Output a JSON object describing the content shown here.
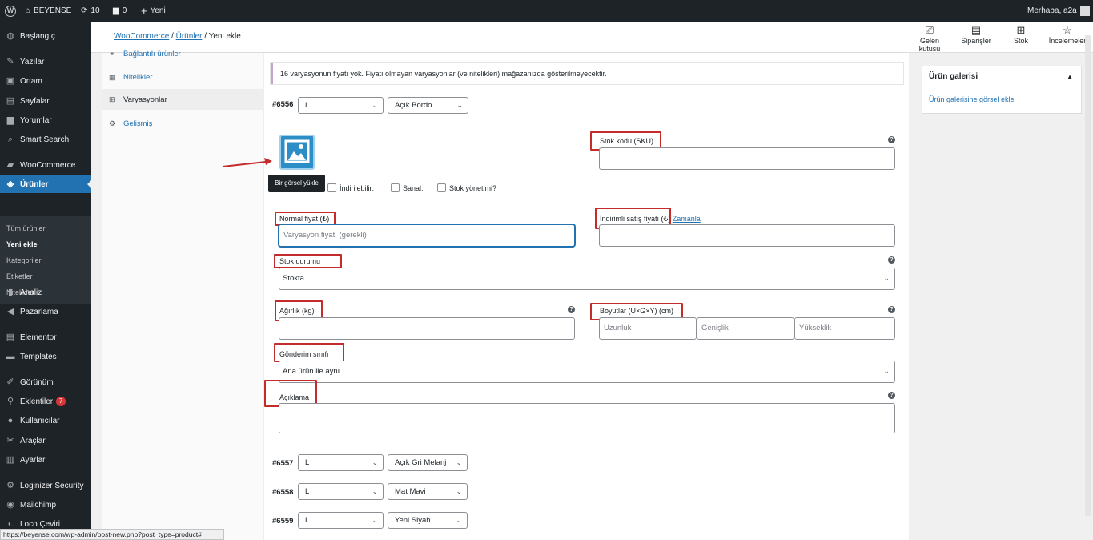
{
  "adminbar": {
    "site_name": "BEYENSE",
    "updates_count": "10",
    "comments_count": "0",
    "new_label": "Yeni",
    "greeting": "Merhaba, a2a"
  },
  "sidebar": {
    "items": [
      {
        "label": "Başlangıç",
        "icon": "dashboard-icon"
      },
      {
        "label": "Yazılar",
        "icon": "pin-icon"
      },
      {
        "label": "Ortam",
        "icon": "media-icon"
      },
      {
        "label": "Sayfalar",
        "icon": "page-icon"
      },
      {
        "label": "Yorumlar",
        "icon": "comment-icon"
      },
      {
        "label": "Smart Search",
        "icon": "search-icon"
      },
      {
        "label": "WooCommerce",
        "icon": "woo-icon"
      },
      {
        "label": "Ürünler",
        "icon": "box-icon"
      },
      {
        "label": "Analiz",
        "icon": "chart-icon"
      },
      {
        "label": "Pazarlama",
        "icon": "megaphone-icon"
      },
      {
        "label": "Elementor",
        "icon": "elementor-icon"
      },
      {
        "label": "Templates",
        "icon": "folder-icon"
      },
      {
        "label": "Görünüm",
        "icon": "brush-icon"
      },
      {
        "label": "Eklentiler",
        "icon": "plugin-icon",
        "badge": "7"
      },
      {
        "label": "Kullanıcılar",
        "icon": "user-icon"
      },
      {
        "label": "Araçlar",
        "icon": "wrench-icon"
      },
      {
        "label": "Ayarlar",
        "icon": "settings-icon"
      },
      {
        "label": "Loginizer Security",
        "icon": "gear-icon"
      },
      {
        "label": "Mailchimp",
        "icon": "mailchimp-icon"
      },
      {
        "label": "Loco Çeviri",
        "icon": "translate-icon"
      }
    ],
    "submenu": [
      "Tüm ürünler",
      "Yeni ekle",
      "Kategoriler",
      "Etiketler",
      "Nitelikler"
    ]
  },
  "header": {
    "breadcrumb": {
      "woocommerce": "WooCommerce",
      "urunler": "Ürünler",
      "current": "Yeni ekle"
    },
    "actions": [
      {
        "label": "Gelen kutusu",
        "icon": "inbox-icon"
      },
      {
        "label": "Siparişler",
        "icon": "orders-icon"
      },
      {
        "label": "Stok",
        "icon": "stock-icon"
      },
      {
        "label": "İncelemeler",
        "icon": "star-icon"
      }
    ]
  },
  "tabs": [
    {
      "label": "Bağlantılı ürünler",
      "icon": "link-icon"
    },
    {
      "label": "Nitelikler",
      "icon": "attributes-icon"
    },
    {
      "label": "Varyasyonlar",
      "icon": "grid-icon"
    },
    {
      "label": "Gelişmiş",
      "icon": "gear-icon"
    }
  ],
  "notice": "16 varyasyonun fiyatı yok. Fiyatı olmayan varyasyonlar (ve nitelikleri) mağazanızda gösterilmeyecektir.",
  "variation_main": {
    "id": "#6556",
    "size": "L",
    "color": "Açık Bordo",
    "tooltip": "Bir görsel yükle",
    "checkboxes": {
      "downloadable": "İndirilebilir:",
      "virtual": "Sanal:",
      "stock_mgmt": "Stok yönetimi?"
    },
    "sku_label": "Stok kodu (SKU)",
    "regular_price_label": "Normal fiyat (₺)",
    "regular_price_placeholder": "Varyasyon fiyatı (gerekli)",
    "sale_price_label": "İndirimli satış fiyatı (₺)",
    "schedule_link": "Zamanla",
    "stock_status_label": "Stok durumu",
    "stock_status_value": "Stokta",
    "weight_label": "Ağırlık (kg)",
    "dimensions_label": "Boyutlar (U×G×Y) (cm)",
    "length_placeholder": "Uzunluk",
    "width_placeholder": "Genişlik",
    "height_placeholder": "Yükseklik",
    "shipping_class_label": "Gönderim sınıfı",
    "shipping_class_value": "Ana ürün ile aynı",
    "description_label": "Açıklama"
  },
  "other_variations": [
    {
      "id": "#6557",
      "size": "L",
      "color": "Açık Gri Melanj"
    },
    {
      "id": "#6558",
      "size": "L",
      "color": "Mat Mavi"
    },
    {
      "id": "#6559",
      "size": "L",
      "color": "Yeni Siyah"
    }
  ],
  "gallery": {
    "title": "Ürün galerisi",
    "link": "Ürün galerisine görsel ekle"
  },
  "statusbar": "https://beyense.com/wp-admin/post-new.php?post_type=product#",
  "colors": {
    "accent": "#2271b1",
    "highlight": "#c42b2b",
    "sidebar": "#1d2327"
  }
}
